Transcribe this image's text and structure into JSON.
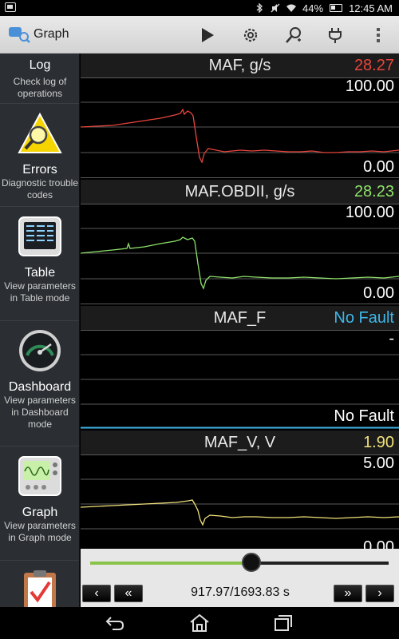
{
  "status_bar": {
    "battery": "44%",
    "time": "12:45 AM"
  },
  "app": {
    "title": "Graph"
  },
  "sidebar": {
    "items": [
      {
        "title": "Log",
        "desc": "Check log of operations"
      },
      {
        "title": "Errors",
        "desc": "Diagnostic trouble codes"
      },
      {
        "title": "Table",
        "desc": "View parameters in Table mode"
      },
      {
        "title": "Dashboard",
        "desc": "View parameters in Dashboard mode"
      },
      {
        "title": "Graph",
        "desc": "View parameters in Graph mode"
      }
    ]
  },
  "panels": [
    {
      "name": "MAF, g/s",
      "value": "28.27",
      "value_color": "#e8453c",
      "max": "100.00",
      "min": "0.00",
      "line_color": "#e8453c"
    },
    {
      "name": "MAF.OBDII, g/s",
      "value": "28.23",
      "value_color": "#8ee26a",
      "max": "100.00",
      "min": "0.00",
      "line_color": "#8ee26a"
    },
    {
      "name": "MAF_F",
      "value": "No Fault",
      "value_color": "#3fb6e8",
      "max": "-",
      "min": "No Fault"
    },
    {
      "name": "MAF_V, V",
      "value": "1.90",
      "value_color": "#f2e27a",
      "max": "5.00",
      "min": "0.00",
      "line_color": "#f2e27a"
    }
  ],
  "controls": {
    "time": "917.97/1693.83 s",
    "position_fraction": 0.54,
    "prev_label": "‹",
    "rewind_label": "«",
    "fastforward_label": "»",
    "next_label": "›"
  },
  "colors": {
    "slider_fill": "#8bc34a"
  }
}
